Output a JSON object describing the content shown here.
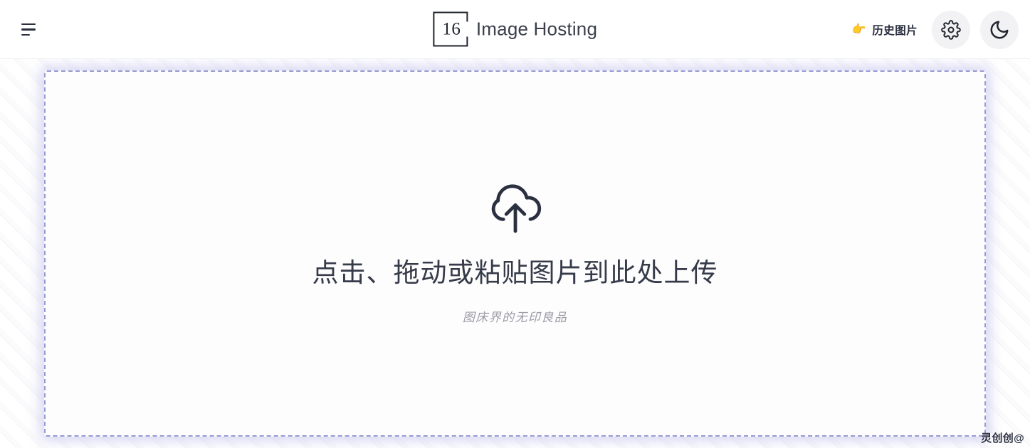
{
  "header": {
    "menu_button_name": "menu",
    "brand": {
      "mark_text": "16",
      "title": "Image Hosting"
    },
    "history": {
      "emoji": "👉",
      "label": "历史图片"
    },
    "settings_button_label": "settings",
    "theme_button_label": "dark mode"
  },
  "dropzone": {
    "title": "点击、拖动或粘贴图片到此处上传",
    "subtitle": "图床界的无印良品",
    "icon": "cloud-upload-icon"
  },
  "watermark": {
    "text": "灵创创@"
  },
  "colors": {
    "accent_border": "#9a9ad4",
    "glow": "#c9c9ef",
    "text_dark": "#2b3040",
    "text_muted": "#9b9ba5",
    "icon_circle_bg": "#f2f2f4",
    "emoji_yellow": "#f3c33a"
  }
}
